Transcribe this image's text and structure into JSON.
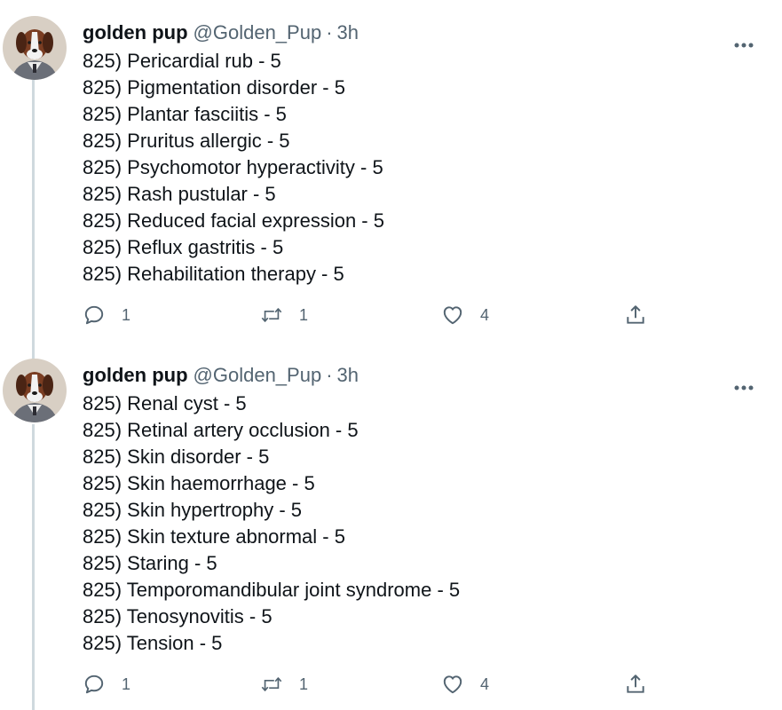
{
  "tweets": [
    {
      "display_name": "golden pup",
      "handle": "@Golden_Pup",
      "separator": "·",
      "time": "3h",
      "lines": [
        "825) Pericardial rub - 5",
        "825) Pigmentation disorder - 5",
        "825) Plantar fasciitis - 5",
        "825) Pruritus allergic - 5",
        "825) Psychomotor hyperactivity - 5",
        "825) Rash pustular - 5",
        "825) Reduced facial expression - 5",
        "825) Reflux gastritis - 5",
        "825) Rehabilitation therapy - 5"
      ],
      "replies": "1",
      "retweets": "1",
      "likes": "4"
    },
    {
      "display_name": "golden pup",
      "handle": "@Golden_Pup",
      "separator": "·",
      "time": "3h",
      "lines": [
        "825) Renal cyst - 5",
        "825) Retinal artery occlusion - 5",
        "825) Skin disorder - 5",
        "825) Skin haemorrhage - 5",
        "825) Skin hypertrophy - 5",
        "825) Skin texture abnormal - 5",
        "825) Staring - 5",
        "825) Temporomandibular joint syndrome - 5",
        "825) Tenosynovitis - 5",
        "825) Tension - 5"
      ],
      "replies": "1",
      "retweets": "1",
      "likes": "4"
    }
  ],
  "icons": {
    "avatar": "dog-portrait-avatar",
    "more": "more-horizontal-icon",
    "reply": "reply-bubble-icon",
    "retweet": "retweet-arrows-icon",
    "like": "heart-icon",
    "share": "share-upload-icon"
  },
  "colors": {
    "text": "#0f1419",
    "secondary": "#536471",
    "thread_line": "#cfd9de"
  }
}
